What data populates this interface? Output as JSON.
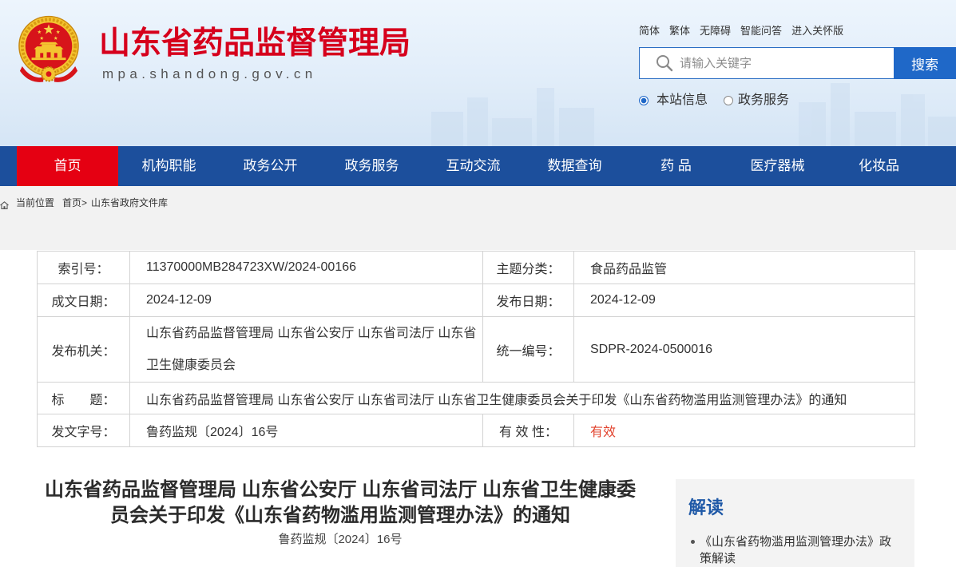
{
  "colors": {
    "brand_red": "#d6001c",
    "nav_blue": "#1c4f9c",
    "nav_active_red": "#e50012",
    "search_blue": "#1f68c8",
    "validity_red": "#e2442f",
    "sidebar_heading_blue": "#1f59a7"
  },
  "header": {
    "emblem_icon": "national-emblem-icon",
    "site_title": "山东省药品监督管理局",
    "site_domain": "mpa.shandong.gov.cn",
    "top_links": [
      {
        "label": "简体"
      },
      {
        "label": "繁体"
      },
      {
        "label": "无障碍"
      },
      {
        "label": "智能问答"
      },
      {
        "label": "进入关怀版"
      }
    ],
    "search": {
      "icon": "search-icon",
      "placeholder": "请输入关键字",
      "value": "",
      "button_label": "搜索"
    },
    "search_scope": [
      {
        "label": "本站信息",
        "selected": true
      },
      {
        "label": "政务服务",
        "selected": false
      }
    ]
  },
  "nav": {
    "items": [
      {
        "label": "首页",
        "active": true
      },
      {
        "label": "机构职能",
        "active": false
      },
      {
        "label": "政务公开",
        "active": false
      },
      {
        "label": "政务服务",
        "active": false
      },
      {
        "label": "互动交流",
        "active": false
      },
      {
        "label": "数据查询",
        "active": false
      },
      {
        "label": "药 品",
        "active": false
      },
      {
        "label": "医疗器械",
        "active": false
      },
      {
        "label": "化妆品",
        "active": false
      }
    ]
  },
  "breadcrumb": {
    "icon": "home-icon",
    "prefix": "当前位置",
    "separator": ">",
    "items": [
      "首页",
      "山东省政府文件库"
    ]
  },
  "meta_table": {
    "rows": [
      [
        {
          "label": "索引号：",
          "value": "11370000MB284723XW/2024-00166"
        },
        {
          "label": "主题分类：",
          "value": "食品药品监管"
        }
      ],
      [
        {
          "label": "成文日期：",
          "value": "2024-12-09"
        },
        {
          "label": "发布日期：",
          "value": "2024-12-09"
        }
      ],
      [
        {
          "label": "发布机关：",
          "value": "山东省药品监督管理局 山东省公安厅 山东省司法厅 山东省卫生健康委员会"
        },
        {
          "label": "统一编号：",
          "value": "SDPR-2024-0500016"
        }
      ],
      [
        {
          "label": "标　　题：",
          "value": "山东省药品监督管理局 山东省公安厅 山东省司法厅 山东省卫生健康委员会关于印发《山东省药物滥用监测管理办法》的通知"
        }
      ],
      [
        {
          "label": "发文字号：",
          "value": "鲁药监规〔2024〕16号"
        },
        {
          "label": "有 效 性：",
          "value": "有效"
        }
      ]
    ]
  },
  "article": {
    "title": "山东省药品监督管理局 山东省公安厅 山东省司法厅 山东省卫生健康委员会关于印发《山东省药物滥用监测管理办法》的通知",
    "doc_number": "鲁药监规〔2024〕16号"
  },
  "sidebar": {
    "heading": "解读",
    "links": [
      "《山东省药物滥用监测管理办法》政策解读"
    ]
  }
}
